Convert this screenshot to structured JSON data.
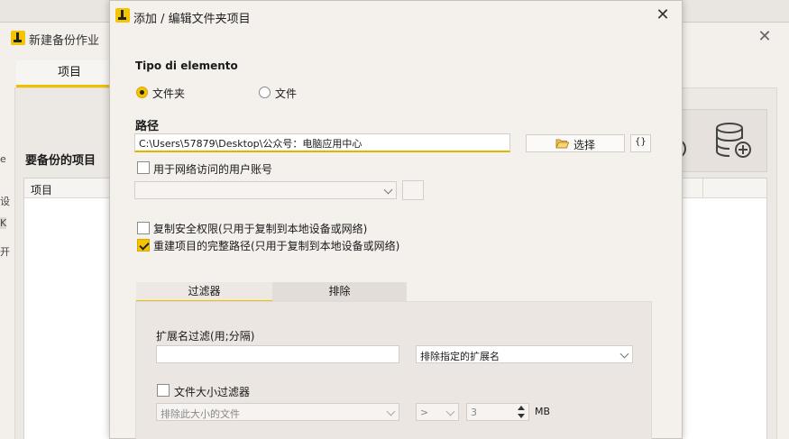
{
  "background_window": {
    "title": "新建备份作业",
    "close_glyph": "✕",
    "tab_label": "项目",
    "section_heading": "要备份的项目",
    "table_header": "项目",
    "edge_fragments": [
      "e",
      "设",
      "K",
      "开"
    ]
  },
  "dialog": {
    "title": "添加 / 编辑文件夹项目",
    "close_glyph": "✕",
    "element_type_label": "Tipo di elemento",
    "radio_folder_label": "文件夹",
    "radio_file_label": "文件",
    "path_label": "路径",
    "path_value": "C:\\Users\\57879\\Desktop\\公众号：电脑应用中心",
    "browse_button_label": "选择",
    "variables_button_label": "{}",
    "network_account_label": "用于网络访问的用户账号",
    "network_account_value": "",
    "copy_security_label": "复制安全权限(只用于复制到本地设备或网络)",
    "copy_security_checked": false,
    "rebuild_path_label": "重建项目的完整路径(只用于复制到本地设备或网络)",
    "rebuild_path_checked": true,
    "tabs": [
      {
        "label": "过滤器",
        "active": true
      },
      {
        "label": "排除",
        "active": false
      }
    ],
    "ext_filter_label": "扩展名过滤(用;分隔)",
    "ext_filter_value": "",
    "ext_mode_value": "排除指定的扩展名",
    "size_filter_label": "文件大小过滤器",
    "size_filter_checked": false,
    "size_mode_value": "排除此大小的文件",
    "size_op_value": ">",
    "size_amount_value": "3",
    "size_unit": "MB"
  },
  "colors": {
    "accent": "#f5c400",
    "window_bg": "#f4f0ec",
    "panel_bg": "#ebe6e1"
  }
}
